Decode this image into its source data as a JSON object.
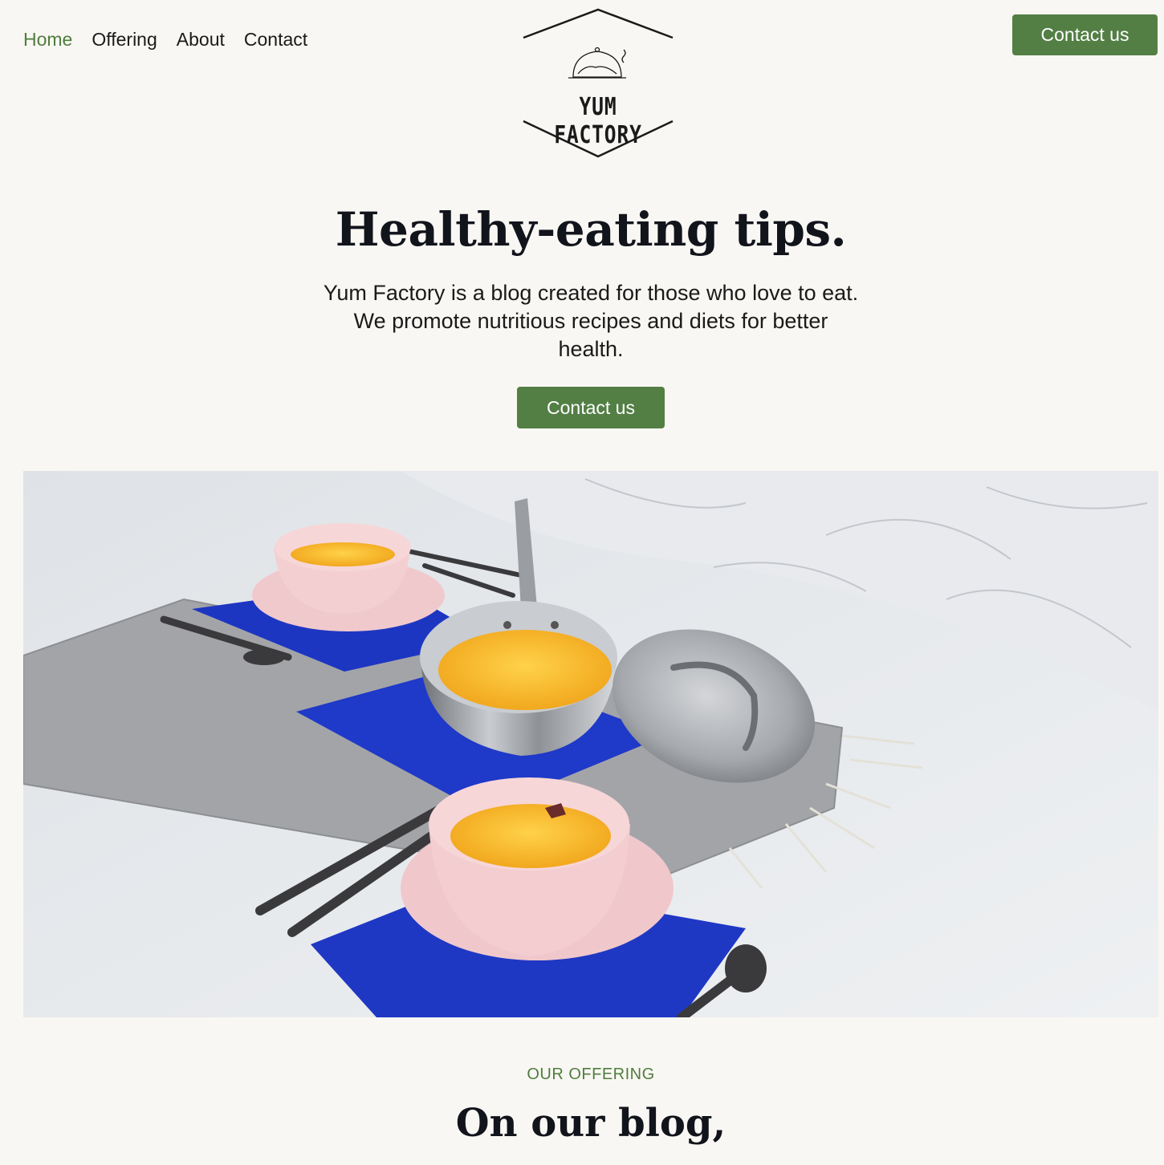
{
  "nav": {
    "items": [
      {
        "label": "Home",
        "active": true
      },
      {
        "label": "Offering",
        "active": false
      },
      {
        "label": "About",
        "active": false
      },
      {
        "label": "Contact",
        "active": false
      }
    ],
    "cta_label": "Contact us"
  },
  "logo": {
    "text": "YUM FACTORY",
    "icon": "cloche-icon"
  },
  "hero": {
    "title": "Healthy-eating tips.",
    "text": "Yum Factory is a blog created for those who love to eat. We promote nutritious recipes and diets for better health.",
    "cta_label": "Contact us"
  },
  "offering": {
    "eyebrow": "OUR OFFERING",
    "title": "On our blog,"
  },
  "colors": {
    "accent": "#537f45",
    "background": "#f9f7f3",
    "text": "#12141c"
  }
}
